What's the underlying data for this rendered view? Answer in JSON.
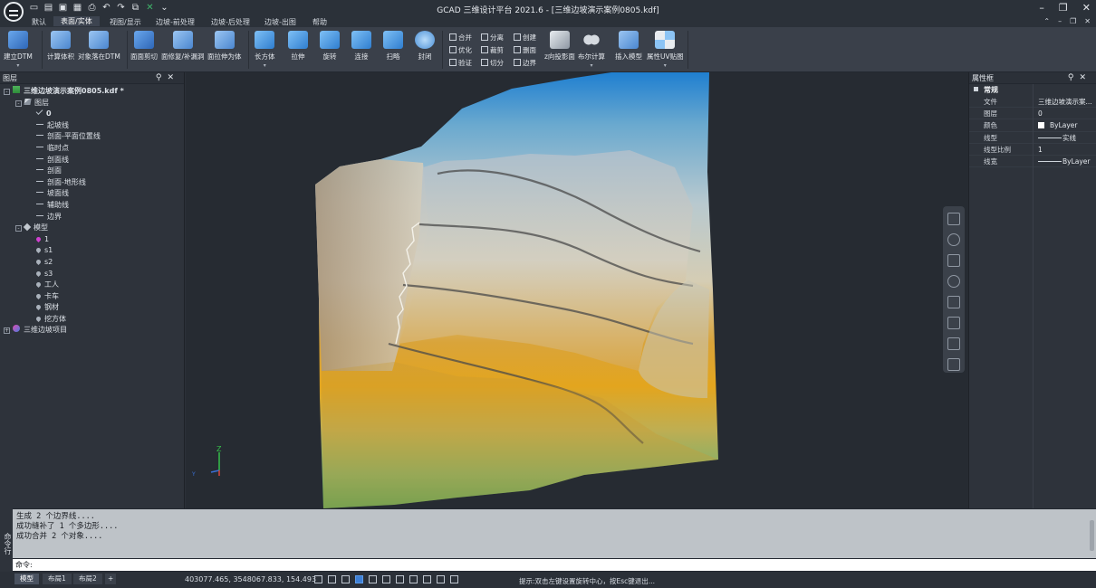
{
  "app": {
    "title": "GCAD 三维设计平台 2021.6 - [三维边坡演示案例0805.kdf]"
  },
  "menu": {
    "tabs": [
      "默认",
      "表面/实体",
      "视图/显示",
      "边坡-前处理",
      "边坡-后处理",
      "边坡-出图",
      "帮助"
    ],
    "active_tab": "表面/实体"
  },
  "ribbon": {
    "buttons": [
      {
        "label": "建立DTM",
        "icon": "dtm-icon",
        "color": "#3b7fd4",
        "dropdown": true
      },
      {
        "label": "计算体积",
        "icon": "volume-icon",
        "color": "#5b9be0"
      },
      {
        "label": "对象落在DTM",
        "icon": "drop-to-dtm-icon",
        "color": "#5b9be0"
      },
      {
        "label": "面面剪切",
        "icon": "surface-cut-icon",
        "color": "#3b7fd4"
      },
      {
        "label": "面修复/补漏洞",
        "icon": "repair-icon",
        "color": "#5b9be0"
      },
      {
        "label": "面拉伸为体",
        "icon": "extrude-surface-icon",
        "color": "#5b9be0"
      },
      {
        "label": "长方体",
        "icon": "box-icon",
        "color": "#4a9de0",
        "dropdown": true
      },
      {
        "label": "拉伸",
        "icon": "extrude-icon",
        "color": "#4a9de0"
      },
      {
        "label": "旋转",
        "icon": "revolve-icon",
        "color": "#4a9de0"
      },
      {
        "label": "连接",
        "icon": "connect-icon",
        "color": "#4a9de0"
      },
      {
        "label": "扫略",
        "icon": "sweep-icon",
        "color": "#4a9de0"
      },
      {
        "label": "封闭",
        "icon": "close-icon",
        "color": "#4a9de0"
      },
      {
        "label": "z向投影面",
        "icon": "z-projection-icon",
        "color": "#c9ced6"
      },
      {
        "label": "布尔计算",
        "icon": "boolean-icon",
        "color": "#c9ced6",
        "dropdown": true
      },
      {
        "label": "插入模型",
        "icon": "insert-model-icon",
        "color": "#5b9be0"
      },
      {
        "label": "属性UV贴图",
        "icon": "uv-map-icon",
        "color": "#5b9be0",
        "dropdown": true
      }
    ],
    "small_commands": [
      {
        "label": "合并"
      },
      {
        "label": "优化"
      },
      {
        "label": "验证"
      },
      {
        "label": "分离"
      },
      {
        "label": "裁剪"
      },
      {
        "label": "切分"
      },
      {
        "label": "创建"
      },
      {
        "label": "删面"
      },
      {
        "label": "边界"
      }
    ]
  },
  "layers_panel": {
    "title": "图层",
    "tree": [
      {
        "label": "三维边坡演示案例0805.kdf *",
        "level": 0,
        "icon": "doc",
        "toggle": "-",
        "bold": true
      },
      {
        "label": "图层",
        "level": 1,
        "icon": "layer",
        "toggle": "-"
      },
      {
        "label": "0",
        "level": 2,
        "icon": "check",
        "bold": true
      },
      {
        "label": "起坡线",
        "level": 2,
        "icon": "line"
      },
      {
        "label": "剖面-平面位置线",
        "level": 2,
        "icon": "line"
      },
      {
        "label": "临时点",
        "level": 2,
        "icon": "line"
      },
      {
        "label": "剖面线",
        "level": 2,
        "icon": "line"
      },
      {
        "label": "剖面",
        "level": 2,
        "icon": "line"
      },
      {
        "label": "剖面-地形线",
        "level": 2,
        "icon": "line"
      },
      {
        "label": "坡面线",
        "level": 2,
        "icon": "line"
      },
      {
        "label": "辅助线",
        "level": 2,
        "icon": "line"
      },
      {
        "label": "边界",
        "level": 2,
        "icon": "line"
      },
      {
        "label": "模型",
        "level": 1,
        "icon": "diamond",
        "toggle": "-"
      },
      {
        "label": "1",
        "level": 2,
        "icon": "dropmag"
      },
      {
        "label": "s1",
        "level": 2,
        "icon": "drop"
      },
      {
        "label": "s2",
        "level": 2,
        "icon": "drop"
      },
      {
        "label": "s3",
        "level": 2,
        "icon": "drop"
      },
      {
        "label": "工人",
        "level": 2,
        "icon": "drop"
      },
      {
        "label": "卡车",
        "level": 2,
        "icon": "drop"
      },
      {
        "label": "钢材",
        "level": 2,
        "icon": "drop"
      },
      {
        "label": "挖方体",
        "level": 2,
        "icon": "drop"
      },
      {
        "label": "三维边坡项目",
        "level": 0,
        "icon": "proj",
        "toggle": "+"
      }
    ]
  },
  "properties_panel": {
    "title": "属性框",
    "section": "常规",
    "rows": [
      {
        "key": "文件",
        "value": "三维边坡演示案..."
      },
      {
        "key": "图层",
        "value": "0"
      },
      {
        "key": "颜色",
        "value": "ByLayer",
        "swatch": "#ffffff"
      },
      {
        "key": "线型",
        "value": "实线",
        "dash": true
      },
      {
        "key": "线型比例",
        "value": "1"
      },
      {
        "key": "线宽",
        "value": "ByLayer",
        "dash": true
      }
    ]
  },
  "viewport": {
    "axis_z": "Z",
    "axis_y": "Y"
  },
  "command": {
    "tab_label": "命令行",
    "history": [
      "生成 2 个边界线....",
      "成功缝补了 1 个多边形....",
      "成功合并 2 个对象...."
    ],
    "prompt": "命令:",
    "input_value": ""
  },
  "status": {
    "tabs": [
      "模型",
      "布局1",
      "布局2"
    ],
    "active_tab": "模型",
    "add_tab": "+",
    "coordinates": "403077.465, 3548067.833, 154.493",
    "hint": "提示:双击左键设置旋转中心，按Esc键退出..."
  }
}
